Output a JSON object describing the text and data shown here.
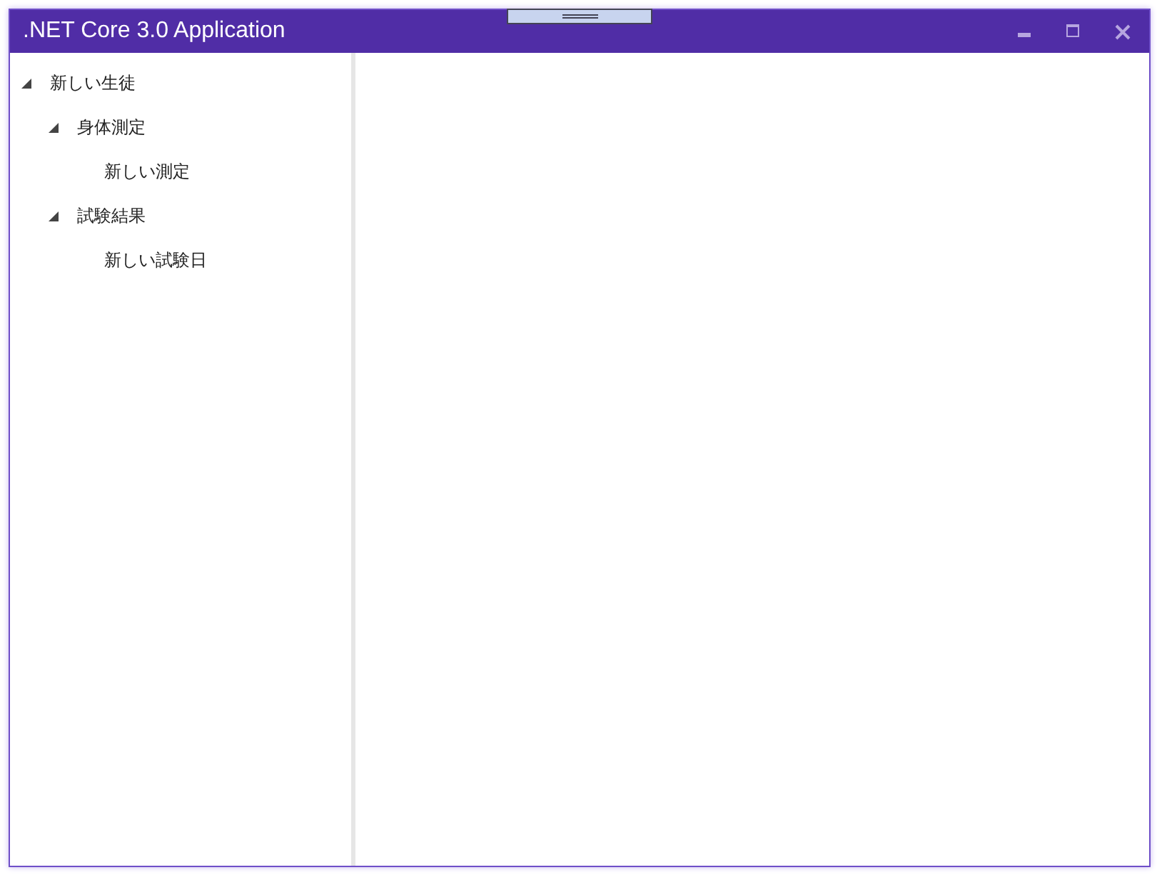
{
  "window": {
    "title": ".NET Core 3.0 Application"
  },
  "tree": [
    {
      "label": "新しい生徒",
      "expanded": true,
      "children": [
        {
          "label": "身体測定",
          "expanded": true,
          "children": [
            {
              "label": "新しい測定"
            }
          ]
        },
        {
          "label": "試験結果",
          "expanded": true,
          "children": [
            {
              "label": "新しい試験日"
            }
          ]
        }
      ]
    }
  ]
}
